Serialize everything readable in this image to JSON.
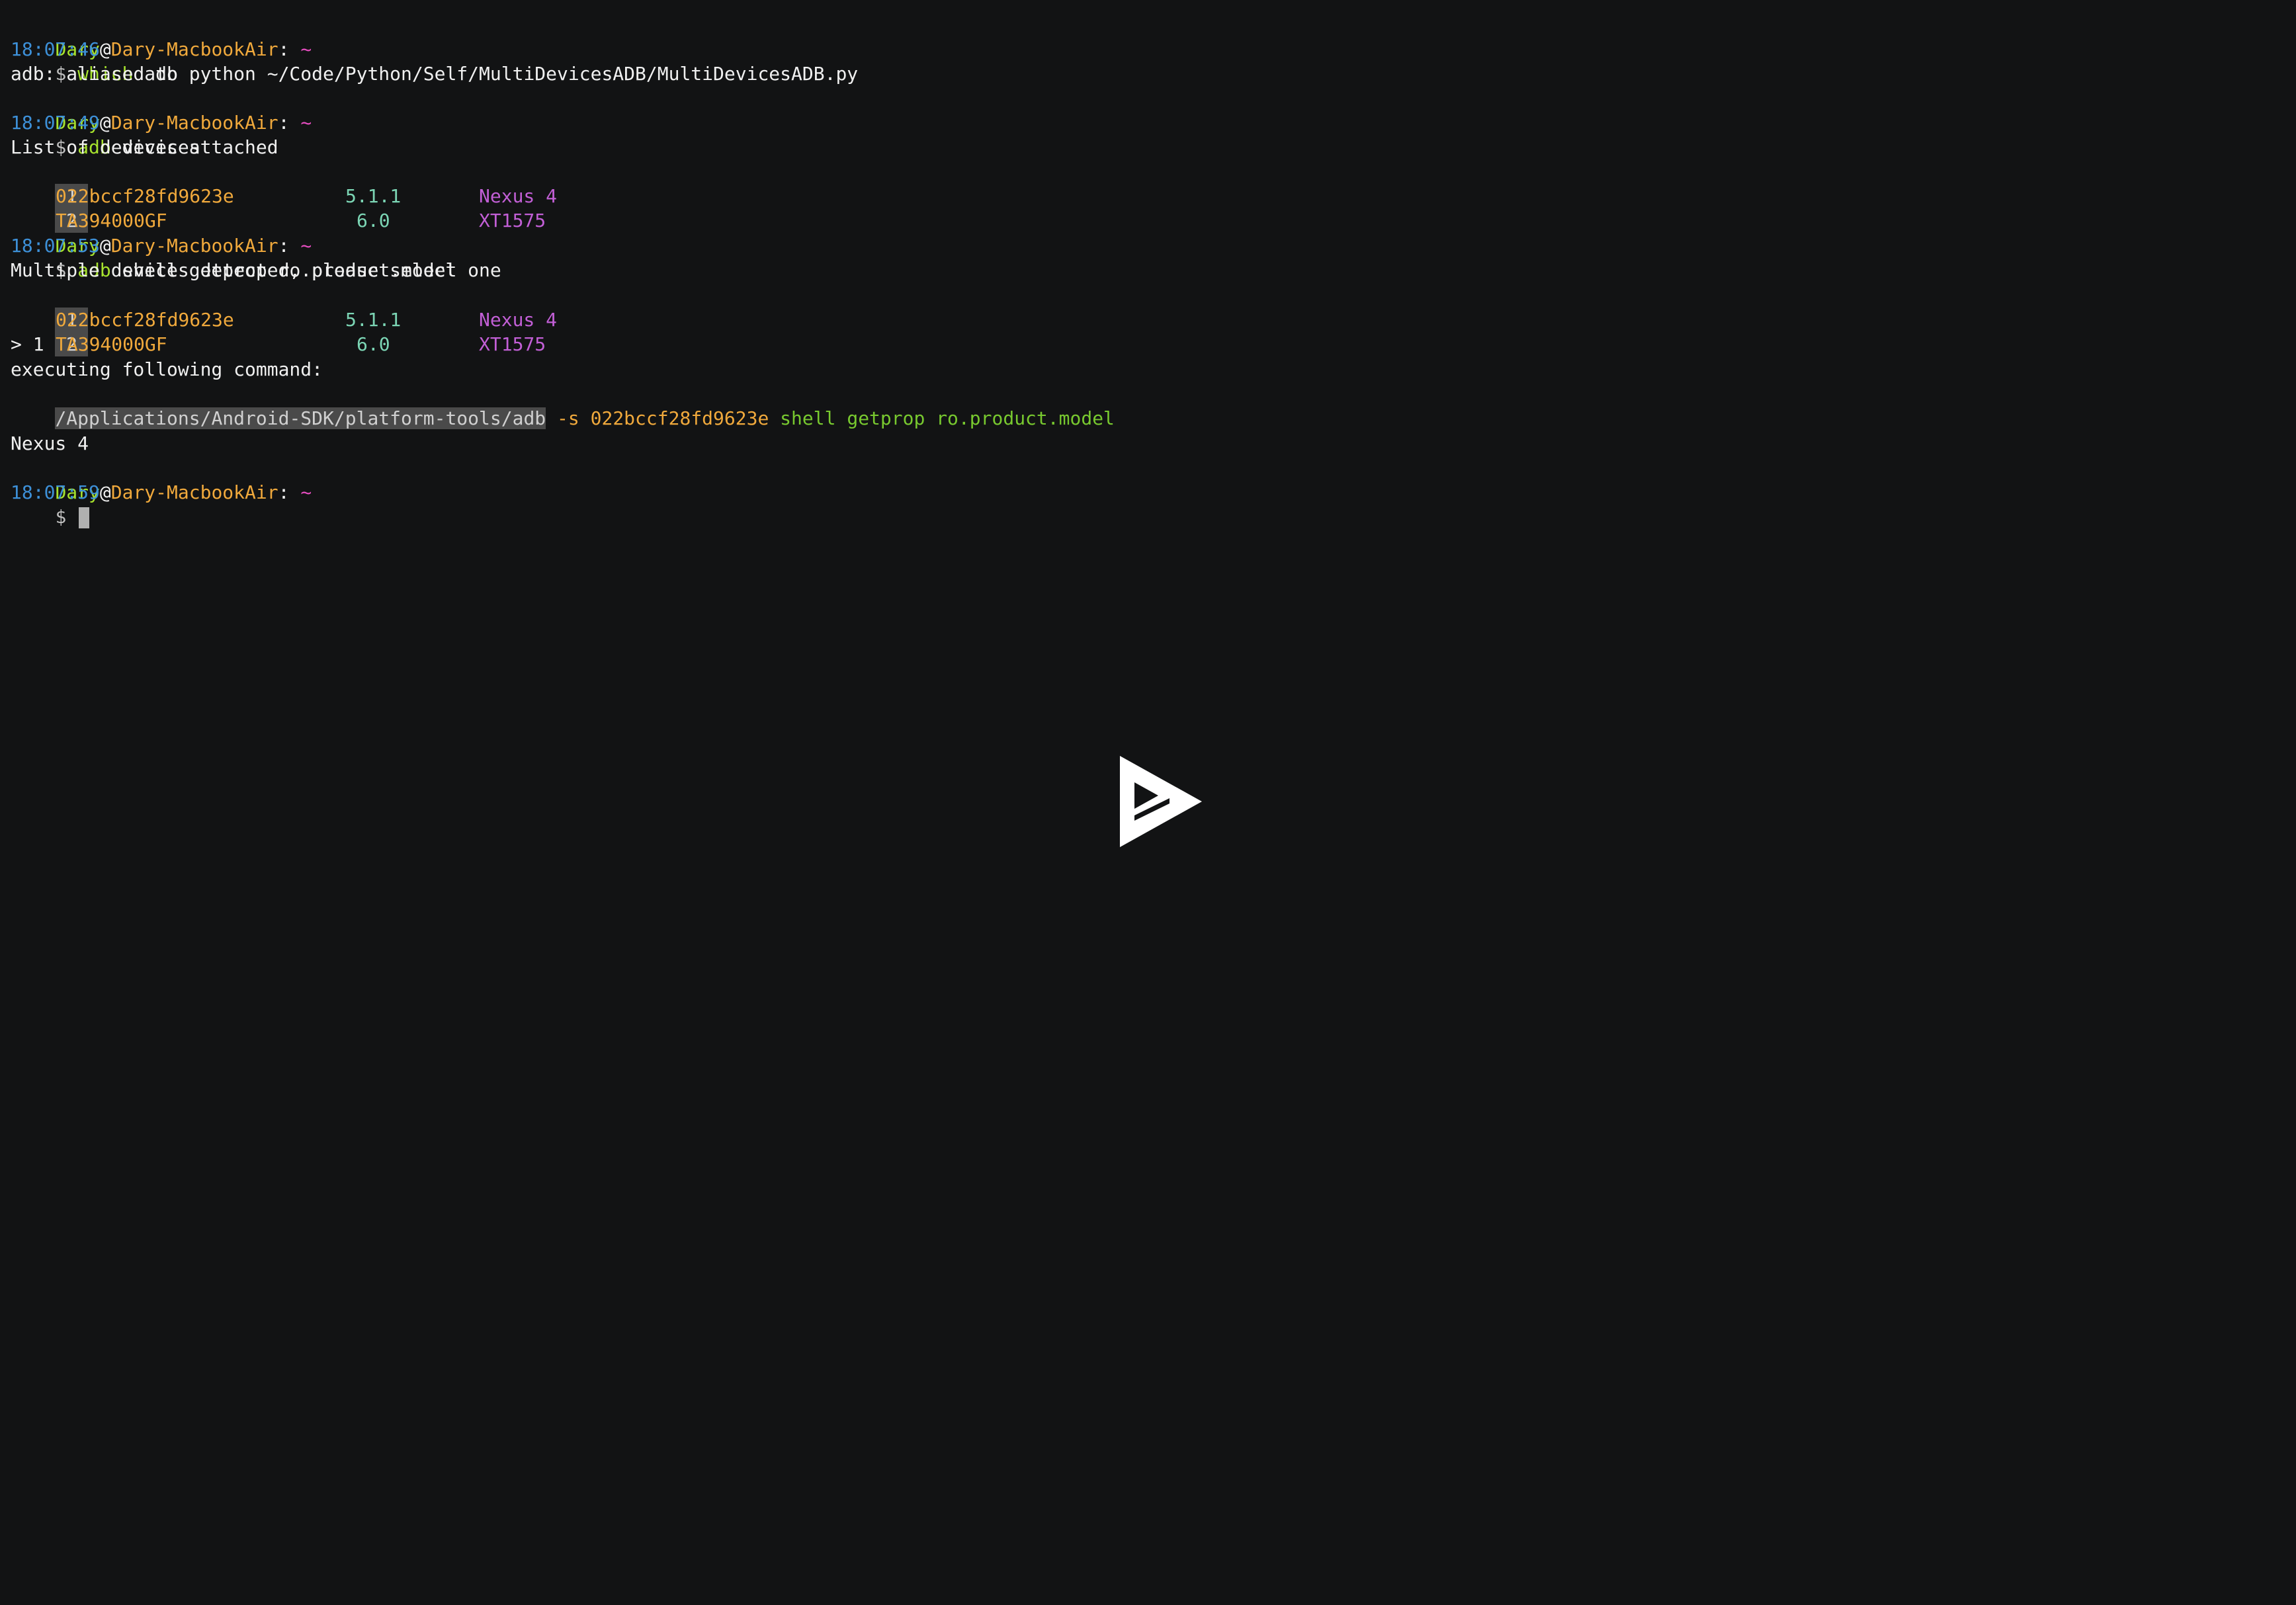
{
  "prompt": {
    "user": "Dary",
    "at": "@",
    "host": "Dary-MacbookAir",
    "sep": ": ",
    "dir": "~",
    "symbol": "$ "
  },
  "blocks": {
    "b1": {
      "cmd_name": "which",
      "cmd_args": " adb",
      "time": "18:07:46",
      "output": "adb: aliased to python ~/Code/Python/Self/MultiDevicesADB/MultiDevicesADB.py"
    },
    "b2": {
      "cmd_name": "adb",
      "cmd_args": " devices",
      "time": "18:07:49",
      "output": "List of devices attached",
      "devices": [
        {
          "index": "1",
          "id": "022bccf28fd9623e",
          "version": "5.1.1",
          "model": "Nexus 4"
        },
        {
          "index": "2",
          "id": "TA394000GF",
          "version": "6.0",
          "model": "XT1575"
        }
      ]
    },
    "b3": {
      "cmd_name": "adb",
      "cmd_args": " shell getprop ro.product.model",
      "time": "18:07:53",
      "output": "Multiple devices detected, please select one",
      "devices": [
        {
          "index": "1",
          "id": "022bccf28fd9623e",
          "version": "5.1.1",
          "model": "Nexus 4"
        },
        {
          "index": "2",
          "id": "TA394000GF",
          "version": "6.0",
          "model": "XT1575"
        }
      ],
      "selection": "> 1",
      "exec_label": "executing following command:",
      "exec_path": "/Applications/Android-SDK/platform-tools/adb",
      "exec_flag": " -s 022bccf28fd9623e",
      "exec_rest": " shell getprop ro.product.model",
      "result": "Nexus 4"
    },
    "b4": {
      "time": "18:07:59"
    }
  },
  "colors": {
    "background": "#121314",
    "timestamp": "#3d90d8",
    "user": "#a6e22e",
    "host": "#f0a93c",
    "dir": "#e64dc0"
  },
  "icons": {
    "player": "asciinema-play-icon"
  }
}
